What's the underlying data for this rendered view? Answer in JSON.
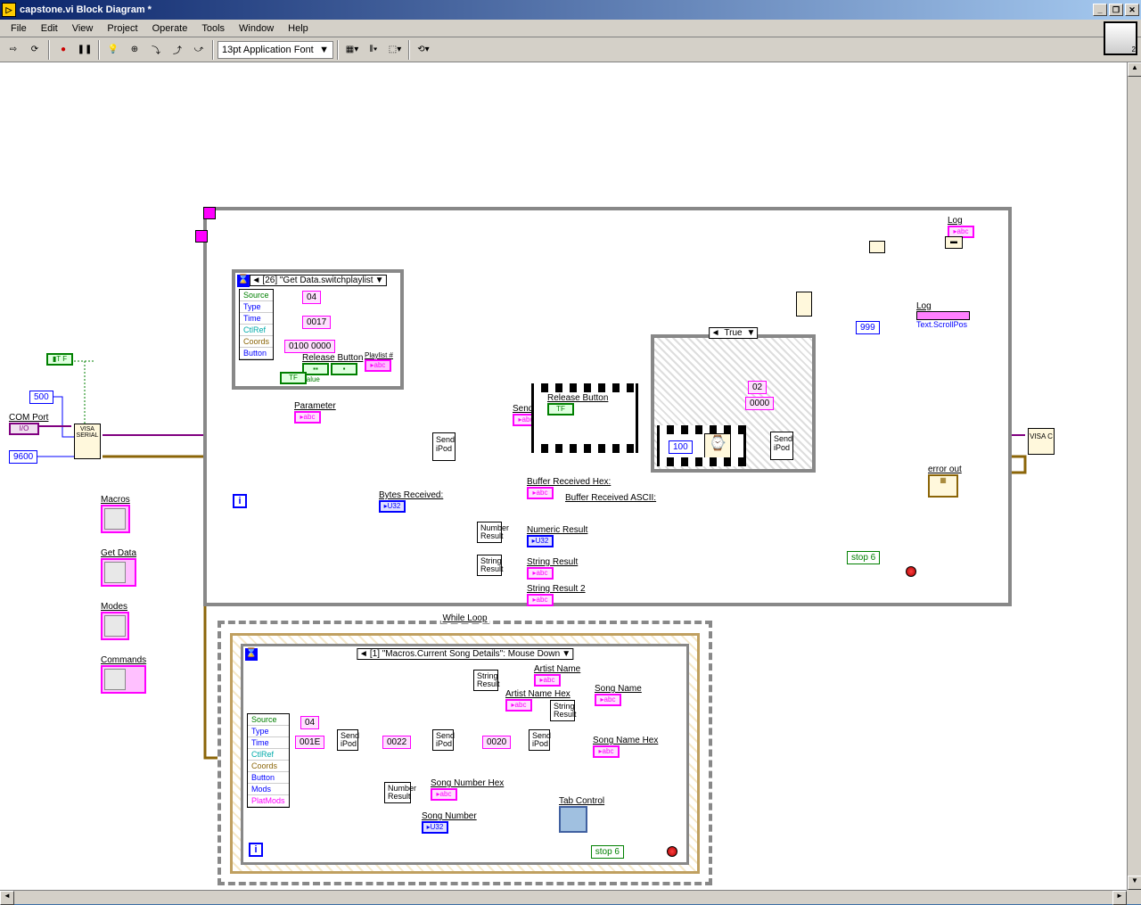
{
  "window": {
    "title": "capstone.vi Block Diagram *",
    "minimize": "_",
    "maximize": "□",
    "restore": "❐",
    "close": "✕"
  },
  "menu": [
    "File",
    "Edit",
    "View",
    "Project",
    "Operate",
    "Tools",
    "Window",
    "Help"
  ],
  "toolbar": {
    "font": "13pt Application Font"
  },
  "canvas": {
    "constants": {
      "baud": "9600",
      "timeout": "500",
      "comport_label": "COM Port",
      "io": "I/O",
      "c04": "04",
      "c0017": "0017",
      "c0100": "0100 0000",
      "c999": "999",
      "c02": "02",
      "c0000": "0000",
      "c100": "100",
      "c001e": "001E",
      "c0022": "0022",
      "c0020": "0020"
    },
    "labels": {
      "macros": "Macros",
      "getdata": "Get Data",
      "modes": "Modes",
      "commands": "Commands",
      "parameter": "Parameter",
      "sendbuff": "Send Buff",
      "bytesrecv": "Bytes Received:",
      "bufhex": "Buffer Received Hex:",
      "bufascii": "Buffer Received ASCII:",
      "numresult": "Numeric Result",
      "strresult": "String Result",
      "strresult2": "String Result 2",
      "log": "Log",
      "textscrollpos": "Text.ScrollPos",
      "errorout": "error out",
      "releasebtn": "Release Button",
      "releasebtn2": "Release Button",
      "playlistnum": "Playlist #",
      "value": "Value",
      "stop": "stop 6",
      "whileloop": "While Loop",
      "artistname": "Artist Name",
      "artistnamehex": "Artist Name Hex",
      "songname": "Song Name",
      "songnamehex": "Song Name Hex",
      "songnum": "Song Number",
      "songnumhex": "Song Number Hex",
      "tabcontrol": "Tab Control",
      "numberresult": "Number Result",
      "stringresult": "String Result",
      "sendipod": "Send iPod"
    },
    "event1_selector": "[26] \"Get Data.switchplaylist ",
    "event2_selector": "[1] \"Macros.Current Song Details\": Mouse Down",
    "case_true": "True",
    "unbundle1": [
      "Source",
      "Type",
      "Time",
      "CtlRef",
      "Coords",
      "Button"
    ],
    "unbundle2": [
      "Source",
      "Type",
      "Time",
      "CtlRef",
      "Coords",
      "Button",
      "Mods",
      "PlatMods"
    ],
    "visa_serial": "VISA SERIAL",
    "visa_c": "VISA C",
    "tf": "TF",
    "u32": "▸U32",
    "abc": "▸abc"
  }
}
